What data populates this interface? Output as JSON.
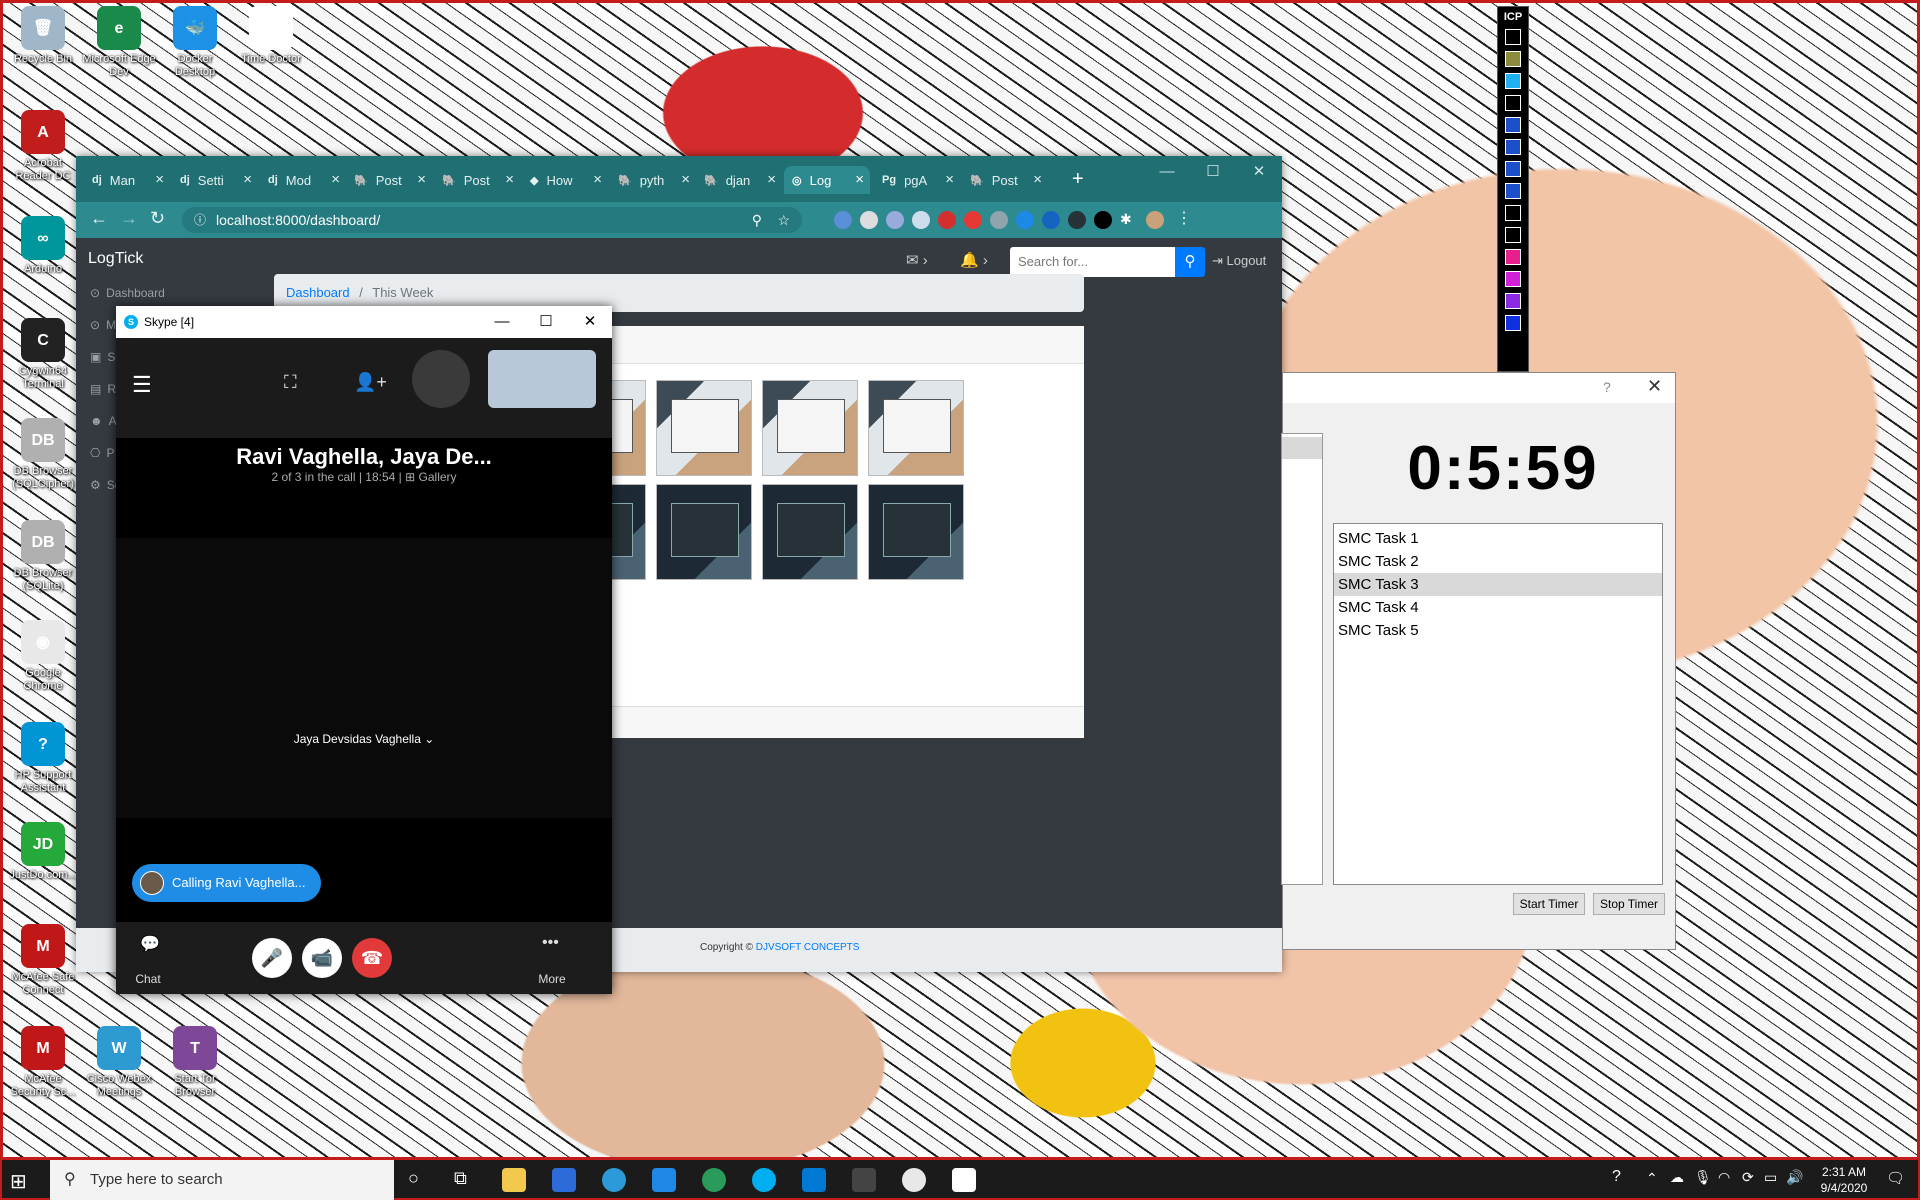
{
  "desktop": {
    "icons": [
      {
        "label": "Recycle Bin",
        "color": "#9fb7c9",
        "glyph": "🗑"
      },
      {
        "label": "Microsoft Edge Dev",
        "color": "#1a8a4a",
        "glyph": "e"
      },
      {
        "label": "Docker Desktop",
        "color": "#1d91e6",
        "glyph": "🐳"
      },
      {
        "label": "Time Doctor",
        "color": "#ffffff",
        "glyph": "✔"
      },
      {
        "label": "Acrobat Reader DC",
        "color": "#c21d1d",
        "glyph": "A"
      },
      {
        "label": "Arduino",
        "color": "#00979c",
        "glyph": "∞"
      },
      {
        "label": "Cygwin64 Terminal",
        "color": "#222222",
        "glyph": "C"
      },
      {
        "label": "DB Browser (SQLCipher)",
        "color": "#b0b0b0",
        "glyph": "DB"
      },
      {
        "label": "DB Browser (SQLite)",
        "color": "#b0b0b0",
        "glyph": "DB"
      },
      {
        "label": "Google Chrome",
        "color": "#e8e8e8",
        "glyph": "◉"
      },
      {
        "label": "HP Support Assistant",
        "color": "#0096d6",
        "glyph": "?"
      },
      {
        "label": "JustDo.com...",
        "color": "#26a93b",
        "glyph": "JD"
      },
      {
        "label": "McAfee Safe Connect",
        "color": "#c01818",
        "glyph": "M"
      },
      {
        "label": "McAfee Security Sc...",
        "color": "#c01818",
        "glyph": "M"
      },
      {
        "label": "Cisco Webex Meetings",
        "color": "#2d9ad1",
        "glyph": "W"
      },
      {
        "label": "Start Tor Browser",
        "color": "#7e4798",
        "glyph": "T"
      }
    ]
  },
  "icp": {
    "label": "ICP"
  },
  "browser": {
    "tabs": [
      {
        "fav": "dj",
        "label": "Man"
      },
      {
        "fav": "dj",
        "label": "Setti"
      },
      {
        "fav": "dj",
        "label": "Mod"
      },
      {
        "fav": "🐘",
        "label": "Post"
      },
      {
        "fav": "🐘",
        "label": "Post"
      },
      {
        "fav": "◆",
        "label": "How"
      },
      {
        "fav": "🐘",
        "label": "pyth"
      },
      {
        "fav": "🐘",
        "label": "djan"
      },
      {
        "fav": "◎",
        "label": "Log"
      },
      {
        "fav": "Pg",
        "label": "pgA"
      },
      {
        "fav": "🐘",
        "label": "Post"
      }
    ],
    "url": "localhost:8000/dashboard/",
    "brand": "LogTick",
    "search_placeholder": "Search for...",
    "logout": "Logout",
    "sidebar": [
      {
        "icon": "⊙",
        "label": "Dashboard"
      },
      {
        "icon": "⊙",
        "label": "Ma"
      },
      {
        "icon": "▣",
        "label": "Sc"
      },
      {
        "icon": "▤",
        "label": "Re"
      },
      {
        "icon": "☻",
        "label": "Ac"
      },
      {
        "icon": "⎔",
        "label": "P"
      },
      {
        "icon": "⚙",
        "label": "Se"
      }
    ],
    "breadcrumb": {
      "link": "Dashboard",
      "sep": "/",
      "current": "This Week"
    },
    "copyright": {
      "text": "Copyright ©",
      "link": "DJVSOFT CONCEPTS"
    }
  },
  "skype": {
    "title": "Skype [4]",
    "call_name": "Ravi Vaghella, Jaya De...",
    "call_sub": "2 of 3 in the call | 18:54 |",
    "gallery": "Gallery",
    "participant": "Jaya Devsidas Vaghella",
    "calling": "Calling Ravi Vaghella...",
    "chat_label": "Chat",
    "more_label": "More"
  },
  "timer": {
    "clock": "0:5:59",
    "tasks": [
      "SMC Task 1",
      "SMC Task 2",
      "SMC Task 3",
      "SMC Task 4",
      "SMC Task 5"
    ],
    "selected_task": "SMC Task 3",
    "start_label": "Start Timer",
    "stop_label": "Stop Timer"
  },
  "taskbar": {
    "search_placeholder": "Type here to search",
    "time": "2:31 AM",
    "date": "9/4/2020"
  }
}
